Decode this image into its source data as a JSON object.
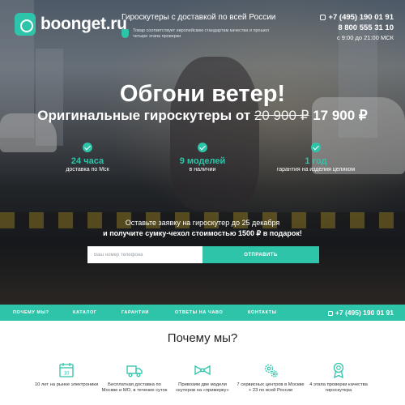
{
  "header": {
    "logo_text": "boonget.ru",
    "tagline_title": "Гироскутеры с доставкой по всей России",
    "tagline_note": "Товар соответствует европейским стандартам качества и прошел четыре этапа проверки",
    "phone1": "+7 (495) 190 01 91",
    "phone2": "8 800 555 31 10",
    "hours": "с 9:00 до 21:00 МСК"
  },
  "hero": {
    "headline": "Обгони ветер!",
    "subhead_prefix": "Оригинальные гироскутеры от ",
    "old_price": "20 900 ₽",
    "new_price": " 17 900 ₽"
  },
  "features": [
    {
      "value": "24 часа",
      "label": "доставка по Мск"
    },
    {
      "value": "9 моделей",
      "label": "в наличии"
    },
    {
      "value": "1 год",
      "label": "гарантия на изделия целиком"
    }
  ],
  "offer": {
    "line1": "Оставьте заявку на гироскутер до 25 декабря",
    "line2": "и получите сумку-чехол стоимостью 1500 ₽ в подарок!",
    "input_placeholder": "Ваш номер телефона",
    "button_label": "ОТПРАВИТЬ"
  },
  "nav": {
    "items": [
      "ПОЧЕМУ МЫ?",
      "КАТАЛОГ",
      "ГАРАНТИИ",
      "ОТВЕТЫ НА ЧАВО",
      "КОНТАКТЫ"
    ],
    "phone": "+7 (495) 190 01 91"
  },
  "why": {
    "title": "Почему мы?",
    "reasons": [
      {
        "icon": "calendar-icon",
        "text": "10 лет на рынке электроники"
      },
      {
        "icon": "truck-icon",
        "text": "Бесплатная доставка по Москве и МО, в течение суток"
      },
      {
        "icon": "bowtie-icon",
        "text": "Привозим две модели скутеров на «примерку»"
      },
      {
        "icon": "gear-icon",
        "text": "7 сервисных центров в Москве + 23 по всей России"
      },
      {
        "icon": "badge-icon",
        "text": "4 этапа проверки качества гироскутера"
      }
    ]
  },
  "colors": {
    "accent": "#2ec4a9"
  }
}
